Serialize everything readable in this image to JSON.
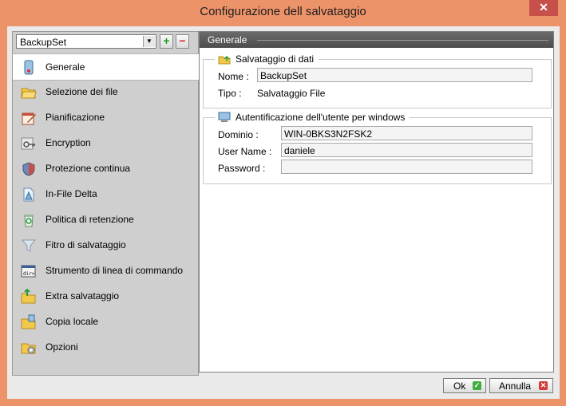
{
  "window": {
    "title": "Configurazione dell salvataggio",
    "close_glyph": "✕"
  },
  "sidebar": {
    "backupset": {
      "selected": "BackupSet"
    },
    "add_glyph": "+",
    "remove_glyph": "−",
    "items": [
      {
        "label": "Generale",
        "icon": "general-device-icon",
        "active": true
      },
      {
        "label": "Selezione dei file",
        "icon": "folder-open-icon"
      },
      {
        "label": "Pianificazione",
        "icon": "calendar-pen-icon"
      },
      {
        "label": "Encryption",
        "icon": "key-icon"
      },
      {
        "label": "Protezione continua",
        "icon": "shield-icon"
      },
      {
        "label": "In-File Delta",
        "icon": "document-delta-icon"
      },
      {
        "label": "Politica di retenzione",
        "icon": "recycle-bin-icon"
      },
      {
        "label": "Fitro di salvataggio",
        "icon": "funnel-filter-icon"
      },
      {
        "label": "Strumento di linea di commando",
        "icon": "command-prompt-icon"
      },
      {
        "label": "Extra salvataggio",
        "icon": "folder-arrows-icon"
      },
      {
        "label": "Copia locale",
        "icon": "folder-copy-icon"
      },
      {
        "label": "Opzioni",
        "icon": "folder-gear-icon"
      }
    ]
  },
  "main": {
    "header": "Generale",
    "backup_group": {
      "title": "Salvataggio di dati",
      "name_label": "Nome :",
      "name_value": "BackupSet",
      "type_label": "Tipo :",
      "type_value": "Salvataggio File"
    },
    "auth_group": {
      "title": "Autentificazione dell'utente per windows",
      "domain_label": "Dominio :",
      "domain_value": "WIN-0BKS3N2FSK2",
      "user_label": "User Name :",
      "user_value": "daniele",
      "password_label": "Password :",
      "password_value": ""
    }
  },
  "footer": {
    "ok_label": "Ok",
    "cancel_label": "Annulla",
    "ok_glyph": "✓",
    "cancel_glyph": "✕"
  },
  "colors": {
    "window_frame": "#ED936A",
    "close_button": "#C7504A",
    "sidebar_bg": "#CFCFCF",
    "header_bg": "#5A5A5A"
  }
}
